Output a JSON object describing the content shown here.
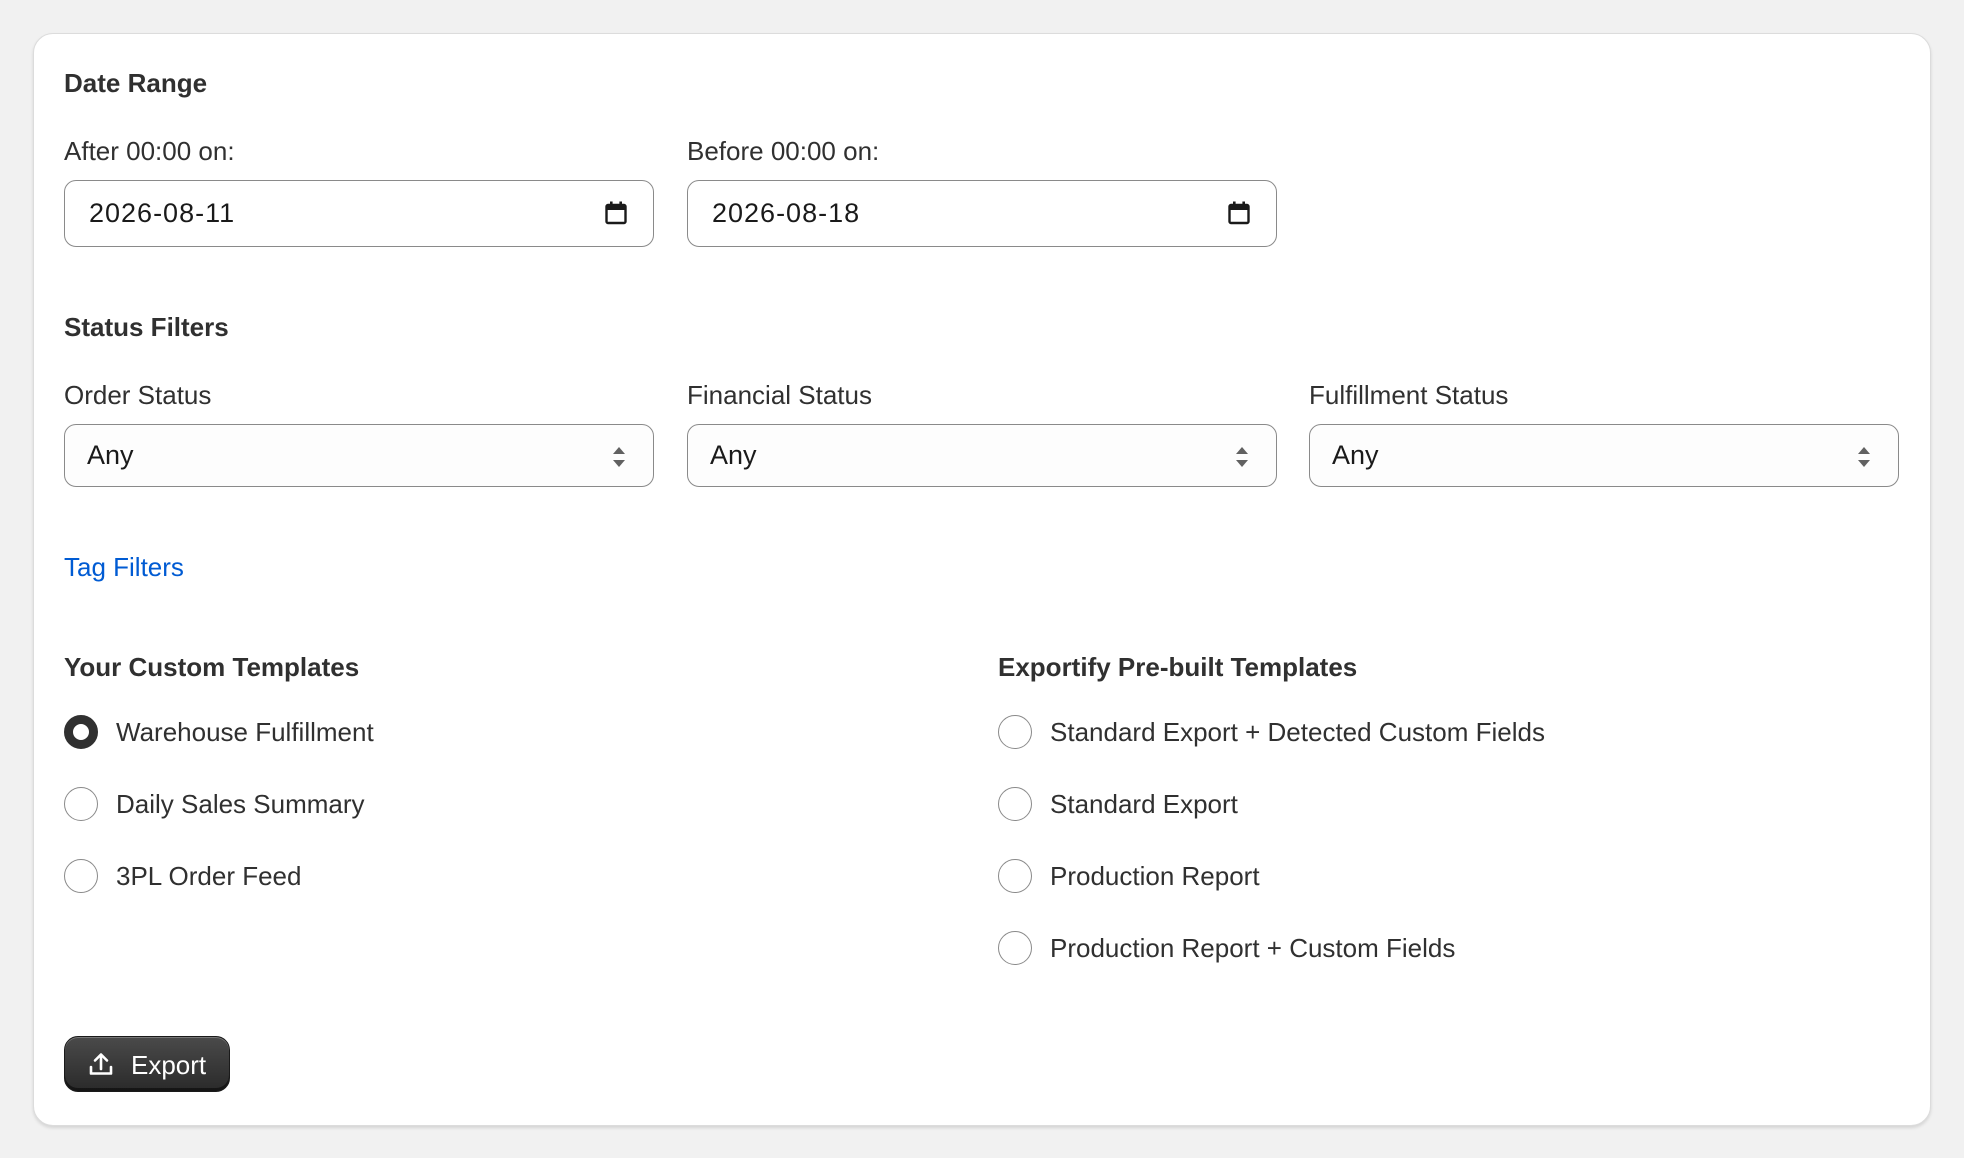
{
  "date_range": {
    "title": "Date Range",
    "after": {
      "label": "After 00:00 on:",
      "value": "2026-08-11"
    },
    "before": {
      "label": "Before 00:00 on:",
      "value": "2026-08-18"
    }
  },
  "status_filters": {
    "title": "Status Filters",
    "order_status": {
      "label": "Order Status",
      "value": "Any"
    },
    "financial_status": {
      "label": "Financial Status",
      "value": "Any"
    },
    "fulfillment_status": {
      "label": "Fulfillment Status",
      "value": "Any"
    }
  },
  "tag_filters": {
    "label": "Tag Filters"
  },
  "custom_templates": {
    "title": "Your Custom Templates",
    "items": [
      {
        "label": "Warehouse Fulfillment",
        "selected": true
      },
      {
        "label": "Daily Sales Summary",
        "selected": false
      },
      {
        "label": "3PL Order Feed",
        "selected": false
      }
    ]
  },
  "prebuilt_templates": {
    "title": "Exportify Pre-built Templates",
    "items": [
      {
        "label": "Standard Export + Detected Custom Fields",
        "selected": false
      },
      {
        "label": "Standard Export",
        "selected": false
      },
      {
        "label": "Production Report",
        "selected": false
      },
      {
        "label": "Production Report + Custom Fields",
        "selected": false
      }
    ]
  },
  "export_button": {
    "label": "Export",
    "icon": "upload-icon"
  },
  "colors": {
    "link": "#005bd3",
    "text": "#303030",
    "button_bg": "#303030",
    "page_bg": "#f1f1f1"
  }
}
